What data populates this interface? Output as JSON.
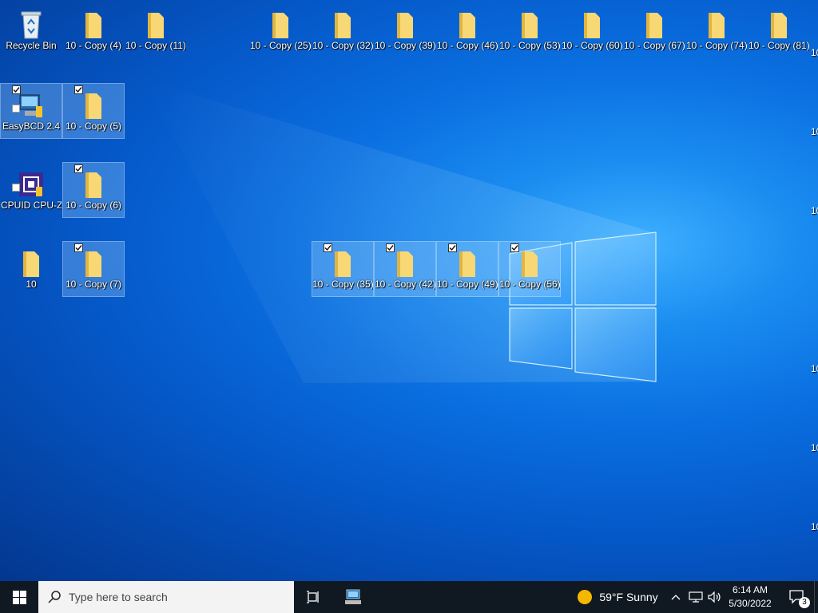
{
  "desktop": {
    "icons_top_row": [
      "Recycle Bin",
      "10 - Copy (4)",
      "10 - Copy (11)",
      "10 - Copy (25)",
      "10 - Copy (32)",
      "10 - Copy (39)",
      "10 - Copy (46)",
      "10 - Copy (53)",
      "10 - Copy (60)",
      "10 - Copy (67)",
      "10 - Copy (74)",
      "10 - Copy (81)"
    ],
    "icons": {
      "easybcd": "EasyBCD 2.4",
      "cpuz": "CPUID CPU-Z",
      "folder10": "10",
      "copy5": "10 - Copy (5)",
      "copy6": "10 - Copy (6)",
      "copy7": "10 - Copy (7)",
      "copy35": "10 - Copy (35)",
      "copy42": "10 - Copy (42)",
      "copy49": "10 - Copy (49)",
      "copy56": "10 - Copy (56)"
    },
    "edge_labels": [
      "10",
      "10",
      "10",
      "10",
      "10",
      "10"
    ]
  },
  "taskbar": {
    "search_placeholder": "Type here to search",
    "weather": "59°F  Sunny",
    "time": "6:14 AM",
    "date": "5/30/2022",
    "notification_count": "3"
  },
  "colors": {
    "taskbar_bg": "#101822",
    "folder_yellow": "#f8d775",
    "selection": "#a0d2ff"
  }
}
